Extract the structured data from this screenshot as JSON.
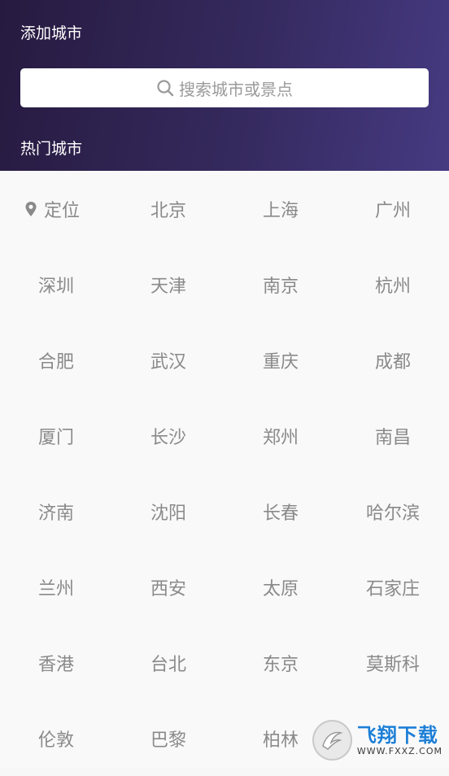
{
  "header": {
    "title": "添加城市",
    "hot_title": "热门城市"
  },
  "search": {
    "icon": "search-icon",
    "placeholder": "搜索城市或景点"
  },
  "cities": [
    {
      "label": "定位",
      "icon": "location-pin-icon"
    },
    {
      "label": "北京"
    },
    {
      "label": "上海"
    },
    {
      "label": "广州"
    },
    {
      "label": "深圳"
    },
    {
      "label": "天津"
    },
    {
      "label": "南京"
    },
    {
      "label": "杭州"
    },
    {
      "label": "合肥"
    },
    {
      "label": "武汉"
    },
    {
      "label": "重庆"
    },
    {
      "label": "成都"
    },
    {
      "label": "厦门"
    },
    {
      "label": "长沙"
    },
    {
      "label": "郑州"
    },
    {
      "label": "南昌"
    },
    {
      "label": "济南"
    },
    {
      "label": "沈阳"
    },
    {
      "label": "长春"
    },
    {
      "label": "哈尔滨"
    },
    {
      "label": "兰州"
    },
    {
      "label": "西安"
    },
    {
      "label": "太原"
    },
    {
      "label": "石家庄"
    },
    {
      "label": "香港"
    },
    {
      "label": "台北"
    },
    {
      "label": "东京"
    },
    {
      "label": "莫斯科"
    },
    {
      "label": "伦敦"
    },
    {
      "label": "巴黎"
    },
    {
      "label": "柏林"
    },
    {
      "label": ""
    }
  ],
  "watermark": {
    "text": "飞翔下载",
    "url_text": "WWW.FXXZ.COM",
    "brand_color": "#1e7fd6"
  }
}
